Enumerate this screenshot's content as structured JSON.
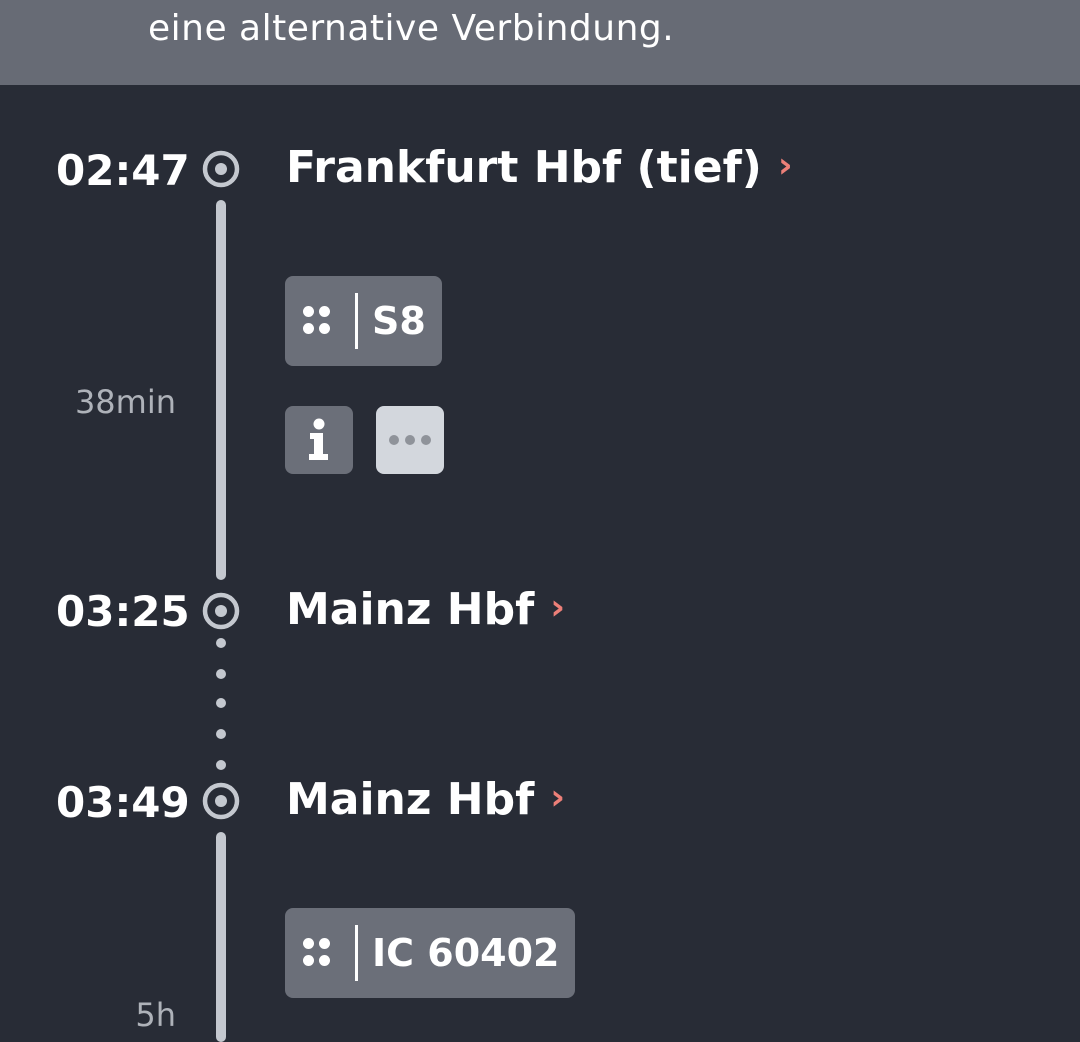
{
  "banner": {
    "text": "eine alternative Verbindung."
  },
  "stops": [
    {
      "time": "02:47",
      "station": "Frankfurt Hbf (tief)"
    },
    {
      "time": "03:25",
      "station": "Mainz Hbf"
    },
    {
      "time": "03:49",
      "station": "Mainz Hbf"
    }
  ],
  "legs": [
    {
      "duration": "38min",
      "train": "S8"
    },
    {
      "duration": "5h",
      "train": "IC 60402"
    }
  ],
  "icons": {
    "chevron": "›",
    "stop": "stop-circle-icon",
    "grip": "grip-dots-icon",
    "info": "info-icon",
    "more": "more-dots-icon"
  },
  "colors": {
    "background": "#282c36",
    "banner": "#676b75",
    "chevron": "#ec7f78",
    "timeline": "#c4c8cf",
    "badge": "#6b6f79",
    "more_button": "#d3d7dd"
  }
}
